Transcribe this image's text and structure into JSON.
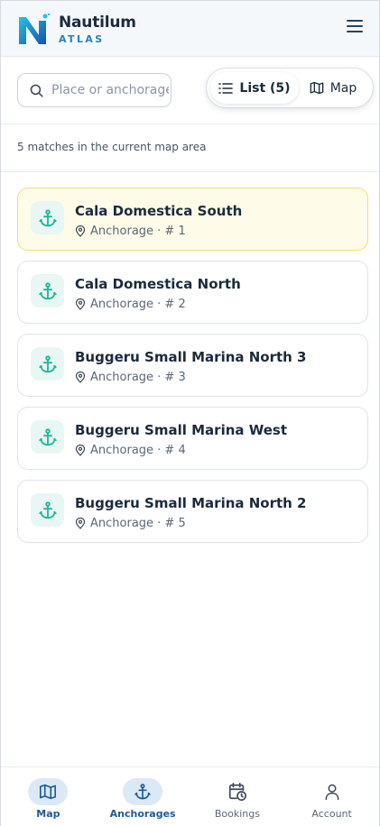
{
  "brand": {
    "name": "Nautilum",
    "subtitle": "ATLAS"
  },
  "search": {
    "placeholder": "Place or anchorage",
    "value": ""
  },
  "view_toggle": {
    "list_label": "List (5)",
    "map_label": "Map",
    "selected": "list"
  },
  "results_summary": "5 matches in the current map area",
  "anchorages": [
    {
      "name": "Cala Domestica South",
      "meta": "Anchorage · # 1",
      "active": true
    },
    {
      "name": "Cala Domestica North",
      "meta": "Anchorage · # 2",
      "active": false
    },
    {
      "name": "Buggeru Small Marina North 3",
      "meta": "Anchorage · # 3",
      "active": false
    },
    {
      "name": "Buggeru Small Marina West",
      "meta": "Anchorage · # 4",
      "active": false
    },
    {
      "name": "Buggeru Small Marina North 2",
      "meta": "Anchorage · # 5",
      "active": false
    }
  ],
  "tabs": [
    {
      "label": "Map",
      "icon": "map-icon",
      "active": true
    },
    {
      "label": "Anchorages",
      "icon": "anchor-icon",
      "active": true
    },
    {
      "label": "Bookings",
      "icon": "calendar-clock-icon",
      "active": false
    },
    {
      "label": "Account",
      "icon": "user-icon",
      "active": false
    }
  ],
  "colors": {
    "accent": "#1d5b99",
    "anchor_teal": "#22b59a",
    "active_card": "#fefbe8"
  }
}
